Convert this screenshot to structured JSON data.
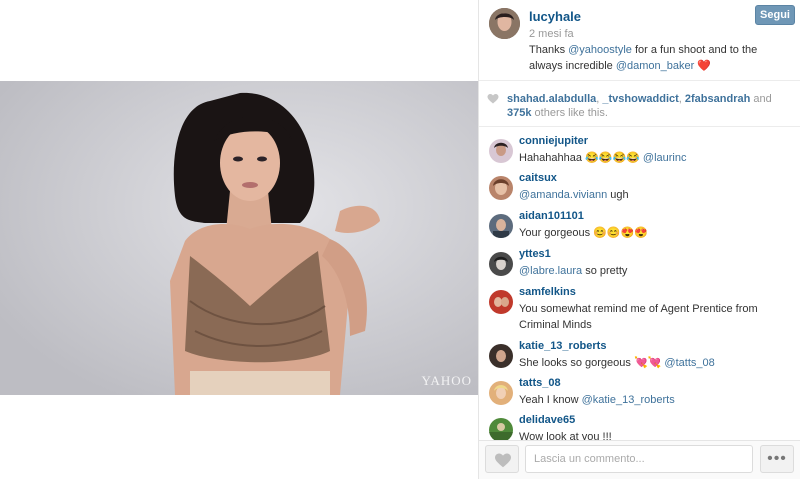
{
  "post": {
    "owner": "lucyhale",
    "time": "2 mesi fa",
    "follow_label": "Segui",
    "caption": {
      "pre": "Thanks ",
      "mention1": "@yahoostyle",
      "mid": " for a fun shoot and to the always incredible ",
      "mention2": "@damon_baker",
      "emoji": "❤️"
    },
    "photo_watermark": "YAHOO"
  },
  "likes": {
    "user1": "shahad.alabdulla",
    "sep1": ", ",
    "user2": "_tvshowaddict",
    "sep2": ", ",
    "user3": "2fabsandrah",
    "and": " and ",
    "count": "375k",
    "suffix": " others like this."
  },
  "comments": [
    {
      "user": "conniejupiter",
      "text": "Hahahahhaa 😂😂😂😂 ",
      "mention": "@laurinc",
      "after": "",
      "avatar_color": "#d8c7d4"
    },
    {
      "user": "caitsux",
      "text": "",
      "mention": "@amanda.viviann",
      "after": " ugh",
      "avatar_color": "#b9846a"
    },
    {
      "user": "aidan101101",
      "text": "Your gorgeous 😊😊😍😍",
      "mention": "",
      "after": "",
      "avatar_color": "#5c6b7d"
    },
    {
      "user": "yttes1",
      "text": "",
      "mention": "@labre.laura",
      "after": " so pretty",
      "avatar_color": "#4a4a4a"
    },
    {
      "user": "samfelkins",
      "text": "You somewhat remind me of Agent Prentice from Criminal Minds",
      "mention": "",
      "after": "",
      "avatar_color": "#c0392b"
    },
    {
      "user": "katie_13_roberts",
      "text": "She looks so gorgeous 💘💘 ",
      "mention": "@tatts_08",
      "after": "",
      "avatar_color": "#3a2f2a"
    },
    {
      "user": "tatts_08",
      "text": "Yeah I know ",
      "mention": "@katie_13_roberts",
      "after": "",
      "avatar_color": "#e2b07a"
    },
    {
      "user": "delidave65",
      "text": "Wow look at you !!!",
      "mention": "",
      "after": "",
      "avatar_color": "#4f8a3a"
    }
  ],
  "footer": {
    "comment_placeholder": "Lascia un commento...",
    "more_label": "•••"
  },
  "colors": {
    "username": "#125688",
    "mention": "#3f729b",
    "follow_button": "#6f97b6"
  },
  "icons": {
    "like_small": "heart-icon",
    "like_button": "heart-icon",
    "more": "ellipsis-icon"
  }
}
